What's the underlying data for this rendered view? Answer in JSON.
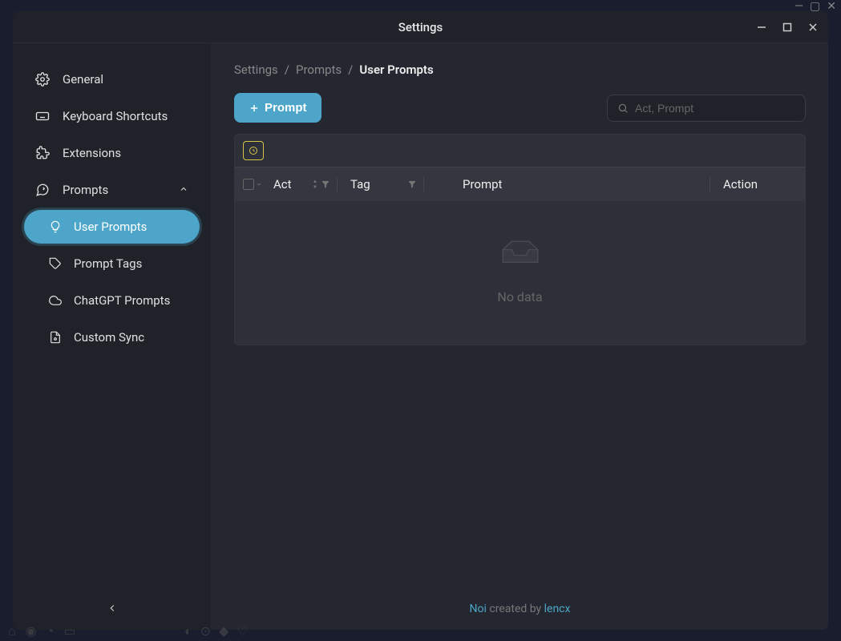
{
  "window": {
    "title": "Settings"
  },
  "sidebar": {
    "items": [
      {
        "label": "General"
      },
      {
        "label": "Keyboard Shortcuts"
      },
      {
        "label": "Extensions"
      },
      {
        "label": "Prompts"
      }
    ],
    "subitems": [
      {
        "label": "User Prompts"
      },
      {
        "label": "Prompt Tags"
      },
      {
        "label": "ChatGPT Prompts"
      },
      {
        "label": "Custom Sync"
      }
    ]
  },
  "breadcrumb": {
    "root": "Settings",
    "parent": "Prompts",
    "current": "User Prompts"
  },
  "toolbar": {
    "add_button": "Prompt"
  },
  "search": {
    "placeholder": "Act, Prompt"
  },
  "table": {
    "headers": {
      "act": "Act",
      "tag": "Tag",
      "prompt": "Prompt",
      "action": "Action"
    },
    "empty": "No data"
  },
  "footer": {
    "app": "Noi",
    "text": " created by ",
    "author": "lencx"
  }
}
